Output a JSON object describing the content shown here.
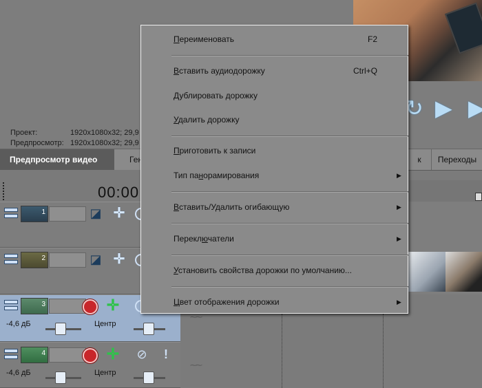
{
  "preview": {
    "project_label": "Проект:",
    "preview_label": "Предпросмотр:",
    "project_value": "1920x1080x32; 29,9",
    "preview_value": "1920x1080x32; 29,9"
  },
  "tabs": {
    "preview_video": "Предпросмотр видео",
    "gen": "Ген",
    "k": "к",
    "transitions": "Переходы"
  },
  "timeline": {
    "time": "00:00:"
  },
  "tracks": [
    {
      "number": "1",
      "type": "video"
    },
    {
      "number": "2",
      "type": "video"
    },
    {
      "number": "3",
      "type": "audio",
      "volume": "-4,6 дБ",
      "pan": "Центр"
    },
    {
      "number": "4",
      "type": "audio",
      "volume": "-4,6 дБ",
      "pan": "Центр"
    }
  ],
  "context_menu": {
    "rename": {
      "accel": "П",
      "rest": "ереименовать",
      "shortcut": "F2"
    },
    "insert_audio": {
      "accel": "В",
      "rest": "ставить аудиодорожку",
      "shortcut": "Ctrl+Q"
    },
    "duplicate": {
      "accel": "Д",
      "rest": "ублировать дорожку"
    },
    "delete": {
      "accel": "У",
      "rest": "далить дорожку"
    },
    "prepare_record": {
      "accel": "П",
      "rest": "риготовить к записи"
    },
    "pan_type": {
      "before": "Тип па",
      "accel": "н",
      "after": "орамирования"
    },
    "insert_envelope": {
      "accel": "В",
      "rest": "ставить/Удалить огибающую"
    },
    "switches": {
      "before": "Перекл",
      "accel": "ю",
      "after": "чатели"
    },
    "set_default": {
      "accel": "У",
      "rest": "становить свойства дорожки по умолчанию..."
    },
    "track_color": {
      "accel": "Ц",
      "rest": "вет отображения дорожки"
    }
  },
  "icons": {
    "play": "play-icon",
    "loop": "loop-icon",
    "next": "next-icon",
    "submenu": "submenu-arrow-icon"
  },
  "colors": {
    "selected_track": "#9bb0cc",
    "record": "#c8262a",
    "menu_bg": "#8a8a8a"
  }
}
